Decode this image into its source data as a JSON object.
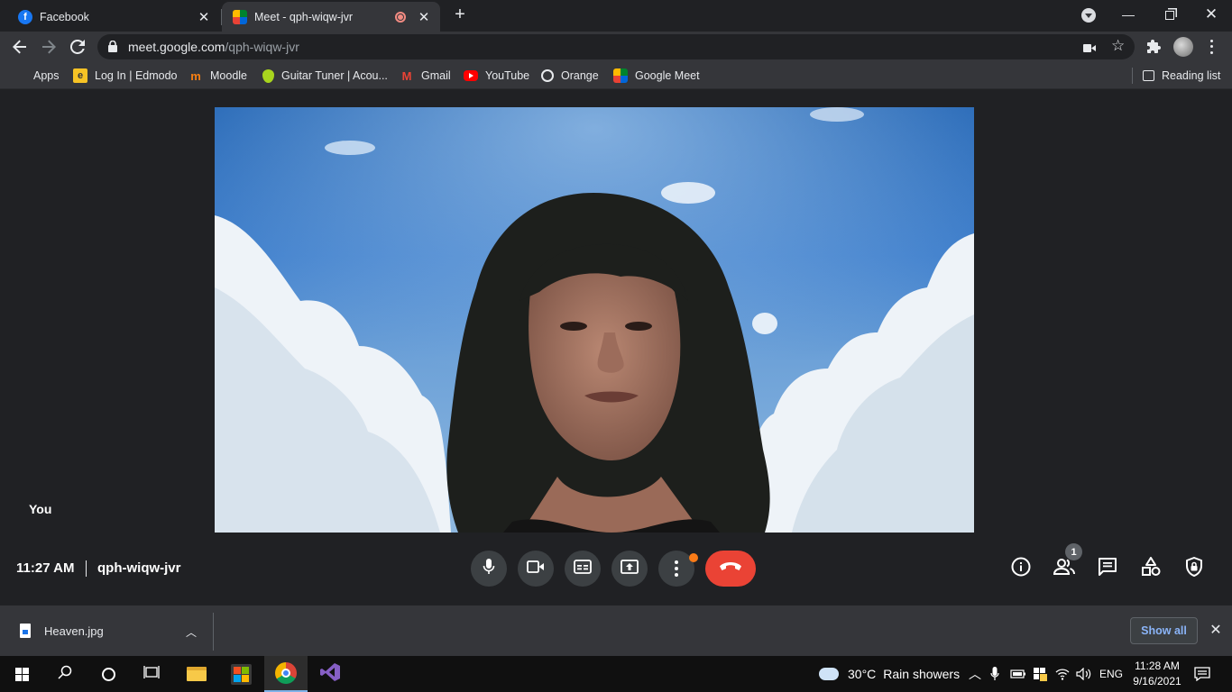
{
  "browser": {
    "tabs": [
      {
        "title": "Facebook",
        "active": false
      },
      {
        "title": "Meet - qph-wiqw-jvr",
        "active": true
      }
    ],
    "new_tab_icon": "plus-icon",
    "url_host": "meet.google.com",
    "url_path": "/qph-wiqw-jvr",
    "bookmarks": [
      {
        "label": "Apps"
      },
      {
        "label": "Log In | Edmodo"
      },
      {
        "label": "Moodle"
      },
      {
        "label": "Guitar Tuner | Acou..."
      },
      {
        "label": "Gmail"
      },
      {
        "label": "YouTube"
      },
      {
        "label": "Orange"
      },
      {
        "label": "Google Meet"
      }
    ],
    "reading_list": "Reading list"
  },
  "meet": {
    "self_label": "You",
    "time": "11:27 AM",
    "meeting_code": "qph-wiqw-jvr",
    "participant_count": "1",
    "colors": {
      "hangup": "#ea4335",
      "control_bg": "#3c4043",
      "notify_dot": "#fa7b17"
    }
  },
  "downloads": {
    "file_name": "Heaven.jpg",
    "show_all": "Show all"
  },
  "taskbar": {
    "weather_temp": "30°C",
    "weather_desc": "Rain showers",
    "language": "ENG",
    "time": "11:28 AM",
    "date": "9/16/2021"
  }
}
